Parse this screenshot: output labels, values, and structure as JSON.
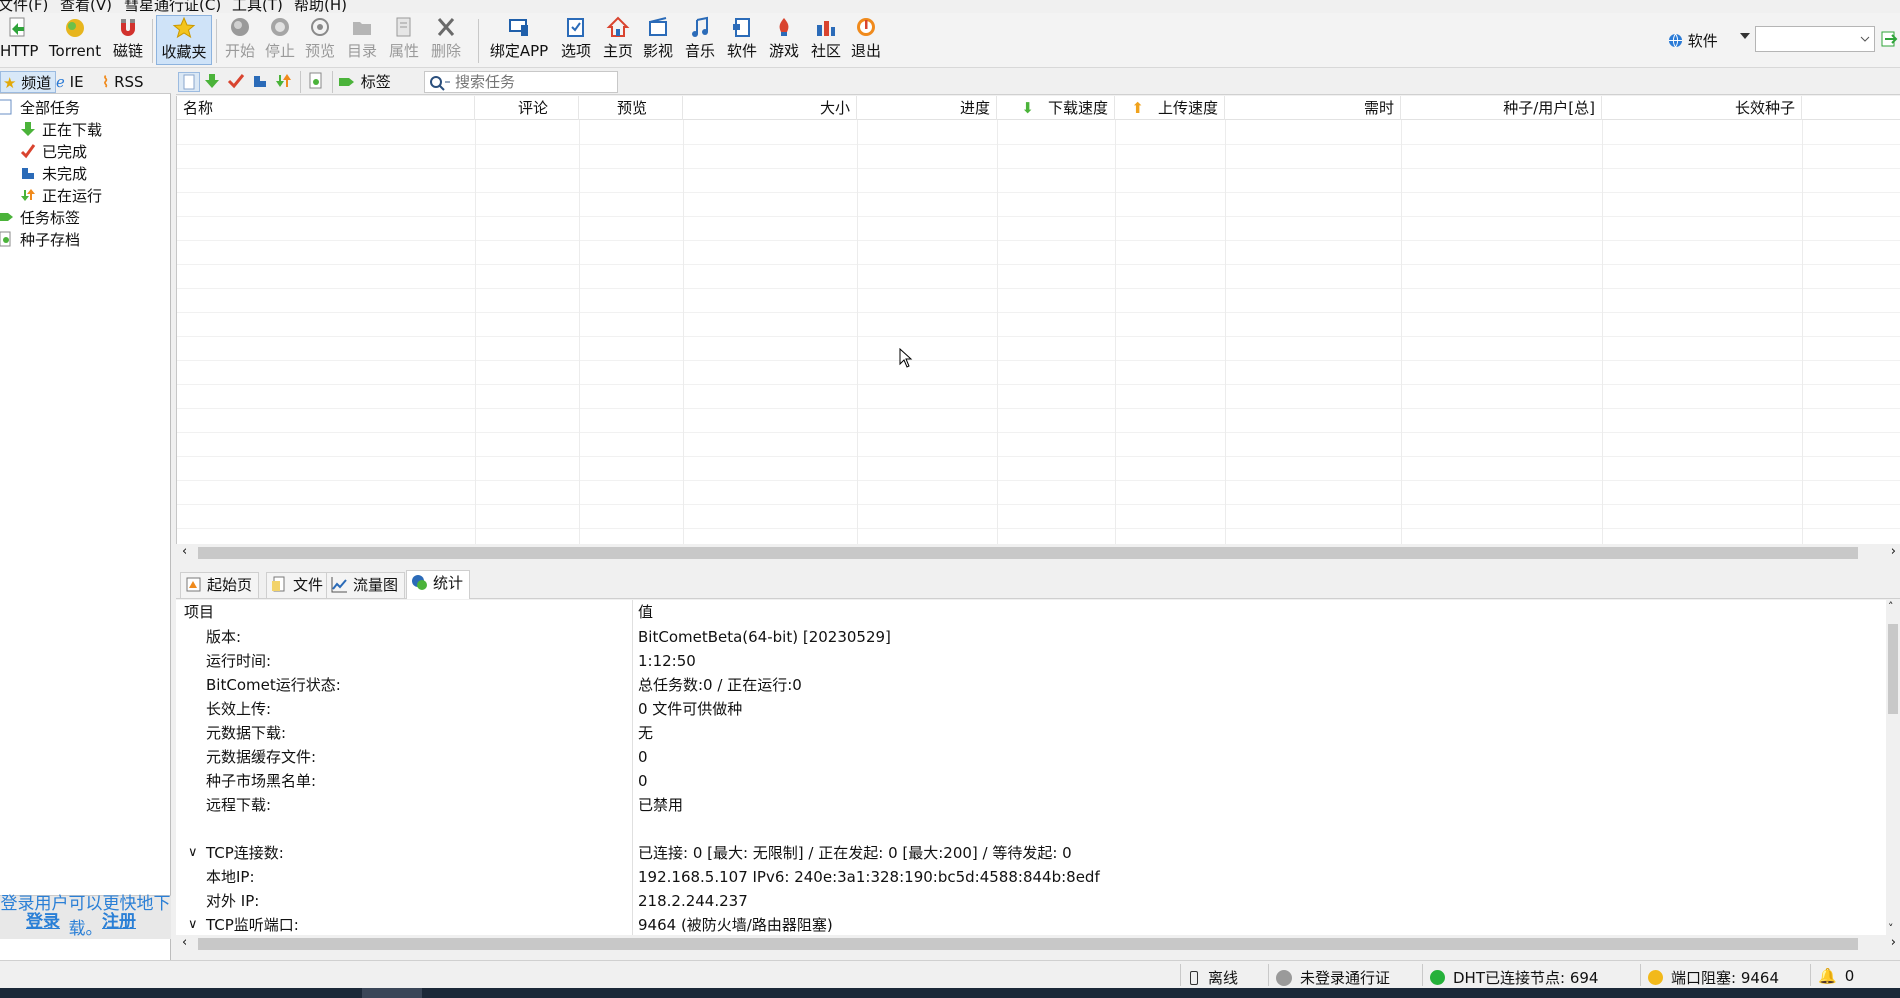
{
  "menu": [
    "文件(F)",
    "查看(V)",
    "彗星通行证(C)",
    "工具(T)",
    "帮助(H)"
  ],
  "toolbar": {
    "http": "HTTP",
    "torrent": "Torrent",
    "magnet": "磁链",
    "favorites": "收藏夹",
    "start": "开始",
    "stop": "停止",
    "preview": "预览",
    "dir": "目录",
    "props": "属性",
    "delete": "删除",
    "bind_app": "绑定APP",
    "options": "选项",
    "home": "主页",
    "video": "影视",
    "music": "音乐",
    "software": "软件",
    "games": "游戏",
    "community": "社区",
    "exit": "退出"
  },
  "software_selector": {
    "label": "软件",
    "value": ""
  },
  "left_tabs": {
    "channel": "频道",
    "ie": "IE",
    "rss": "RSS"
  },
  "tree": {
    "all": "全部任务",
    "downloading": "正在下载",
    "completed": "已完成",
    "incomplete": "未完成",
    "running": "正在运行",
    "tags": "任务标签",
    "archive": "种子存档"
  },
  "login": {
    "login": "登录",
    "register": "注册",
    "hint": "登录用户可以更快地下载。"
  },
  "listbar": {
    "tag_button": "标签",
    "search_placeholder": "搜索任务"
  },
  "columns": [
    "名称",
    "评论",
    "预览",
    "大小",
    "进度",
    "下载速度",
    "上传速度",
    "需时",
    "种子/用户[总]",
    "长效种子"
  ],
  "bottom_tabs": {
    "start": "起始页",
    "files": "文件",
    "traffic": "流量图",
    "stats": "统计"
  },
  "stats": {
    "header_item": "项目",
    "header_value": "值",
    "rows": [
      {
        "k": "版本:",
        "v": "BitCometBeta(64-bit) [20230529]"
      },
      {
        "k": "运行时间:",
        "v": "1:12:50"
      },
      {
        "k": "BitComet运行状态:",
        "v": "总任务数:0 / 正在运行:0"
      },
      {
        "k": "长效上传:",
        "v": "0 文件可供做种"
      },
      {
        "k": "元数据下载:",
        "v": "无"
      },
      {
        "k": "元数据缓存文件:",
        "v": "0"
      },
      {
        "k": "种子市场黑名单:",
        "v": "0"
      },
      {
        "k": "远程下载:",
        "v": "已禁用"
      },
      {
        "k": "TCP连接数:",
        "v": "已连接: 0 [最大: 无限制] / 正在发起: 0 [最大:200] / 等待发起: 0"
      },
      {
        "k": "本地IP:",
        "v": "192.168.5.107    IPv6: 240e:3a1:328:190:bc5d:4588:844b:8edf"
      },
      {
        "k": "对外 IP:",
        "v": "218.2.244.237"
      },
      {
        "k": "TCP监听端口:",
        "v": "9464 (被防火墙/路由器阻塞)"
      }
    ]
  },
  "status": {
    "offline": "离线",
    "passport": "未登录通行证",
    "dht": "DHT已连接节点:  694",
    "port": "端口阻塞:  9464",
    "alerts": "0"
  }
}
